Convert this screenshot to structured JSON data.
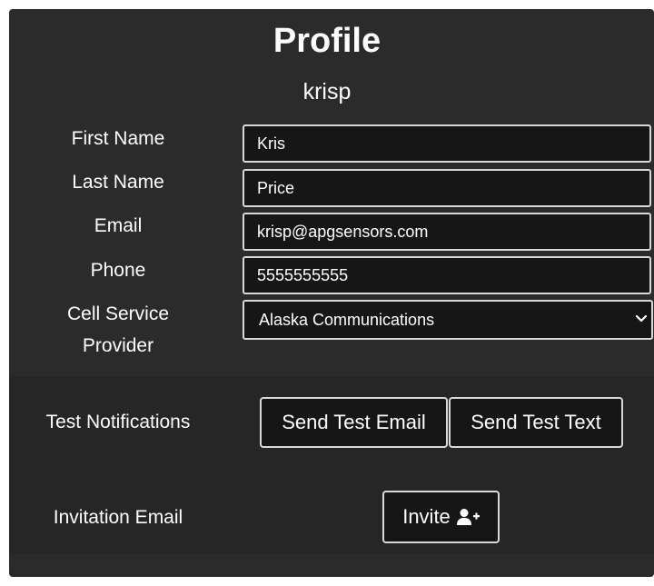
{
  "header": {
    "title": "Profile",
    "username": "krisp"
  },
  "form": {
    "first_name": {
      "label": "First Name",
      "value": "Kris"
    },
    "last_name": {
      "label": "Last Name",
      "value": "Price"
    },
    "email": {
      "label": "Email",
      "value": "krisp@apgsensors.com"
    },
    "phone": {
      "label": "Phone",
      "value": "5555555555"
    },
    "cell_provider": {
      "label_line1": "Cell Service",
      "label_line2": "Provider",
      "selected": "Alaska Communications"
    }
  },
  "test_notifications": {
    "label": "Test Notifications",
    "send_email_label": "Send Test Email",
    "send_text_label": "Send Test Text"
  },
  "invitation": {
    "label": "Invitation Email",
    "invite_label": "Invite",
    "invite_icon": "user-plus-icon"
  },
  "colors": {
    "panel_bg": "#2b2b2b",
    "field_bg": "#161616",
    "field_border": "#d9d9d9",
    "text": "#ffffff"
  }
}
